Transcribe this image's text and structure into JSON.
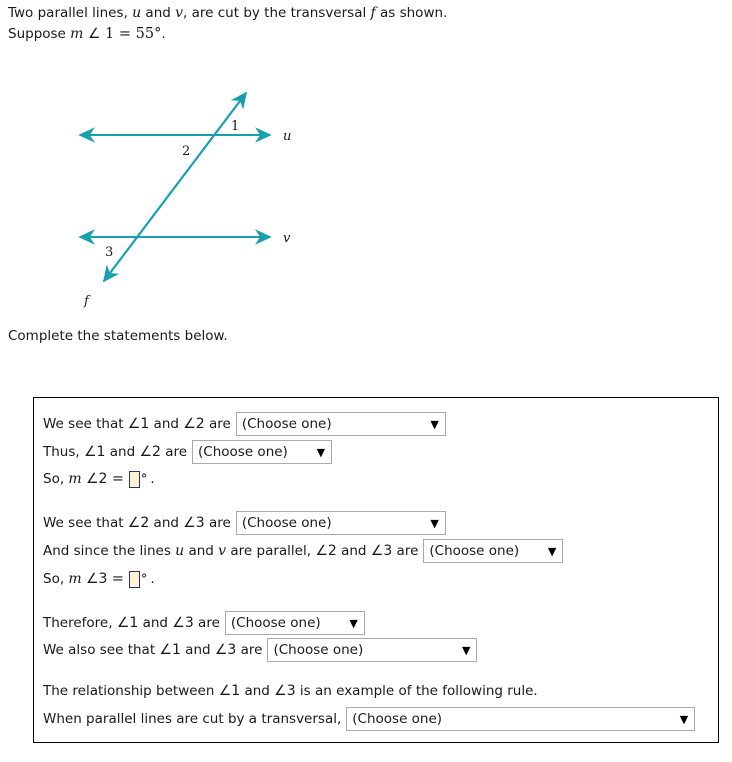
{
  "intro": {
    "line1_a": "Two parallel lines, ",
    "line1_u": "u",
    "line1_b": " and ",
    "line1_v": "v",
    "line1_c": ", are cut by the transversal ",
    "line1_f": "f",
    "line1_d": " as shown.",
    "line2_m": "m",
    "line2_angle": "∠",
    "line2_one": "1",
    "line2_eq": "= 55°",
    "line2_period": "."
  },
  "figure": {
    "label_line_u": "u",
    "label_line_v": "v",
    "label_transversal_f": "f",
    "label_angle_1": "1",
    "label_angle_2": "2",
    "label_angle_3": "3",
    "line_color": "#17a0ae"
  },
  "prompt": {
    "complete": "Complete the statements below."
  },
  "dropdown": {
    "placeholder": "(Choose one)",
    "caret": "▼"
  },
  "statements": {
    "s1": {
      "prefix": "We see that ∠1 and ∠2 are",
      "pre_a": "We see that ",
      "ang1": "∠1",
      "mid": " and ",
      "ang2": "∠2",
      "post": " are"
    },
    "s2": {
      "pre_a": "Thus, ",
      "ang1": "∠1",
      "mid": " and ",
      "ang2": "∠2",
      "post": " are"
    },
    "s3": {
      "pre_so": "So, ",
      "m": "m",
      "ang": "∠2",
      "eq": "=",
      "deg": "°",
      "period": ".",
      "value": ""
    },
    "s4": {
      "pre_a": "We see that ",
      "ang1": "∠2",
      "mid": " and ",
      "ang2": "∠3",
      "post": " are"
    },
    "s5": {
      "pre_a": "And since the lines ",
      "u": "u",
      "mid_and": " and ",
      "v": "v",
      "mid_par": " are parallel, ",
      "ang1": "∠2",
      "mid": " and ",
      "ang2": "∠3",
      "post": " are"
    },
    "s6": {
      "pre_so": "So, ",
      "m": "m",
      "ang": "∠3",
      "eq": "=",
      "deg": "°",
      "period": ".",
      "value": ""
    },
    "s7": {
      "pre_a": "Therefore, ",
      "ang1": "∠1",
      "mid": " and ",
      "ang2": "∠3",
      "post": " are"
    },
    "s8": {
      "pre_a": "We also see that ",
      "ang1": "∠1",
      "mid": " and ",
      "ang2": "∠3",
      "post": " are"
    },
    "s9": {
      "pre_a": "The relationship between ",
      "ang1": "∠1",
      "mid": " and ",
      "ang2": "∠3",
      "post": " is an example of the following rule."
    },
    "s10": {
      "text": "When parallel lines are cut by a transversal,"
    }
  }
}
